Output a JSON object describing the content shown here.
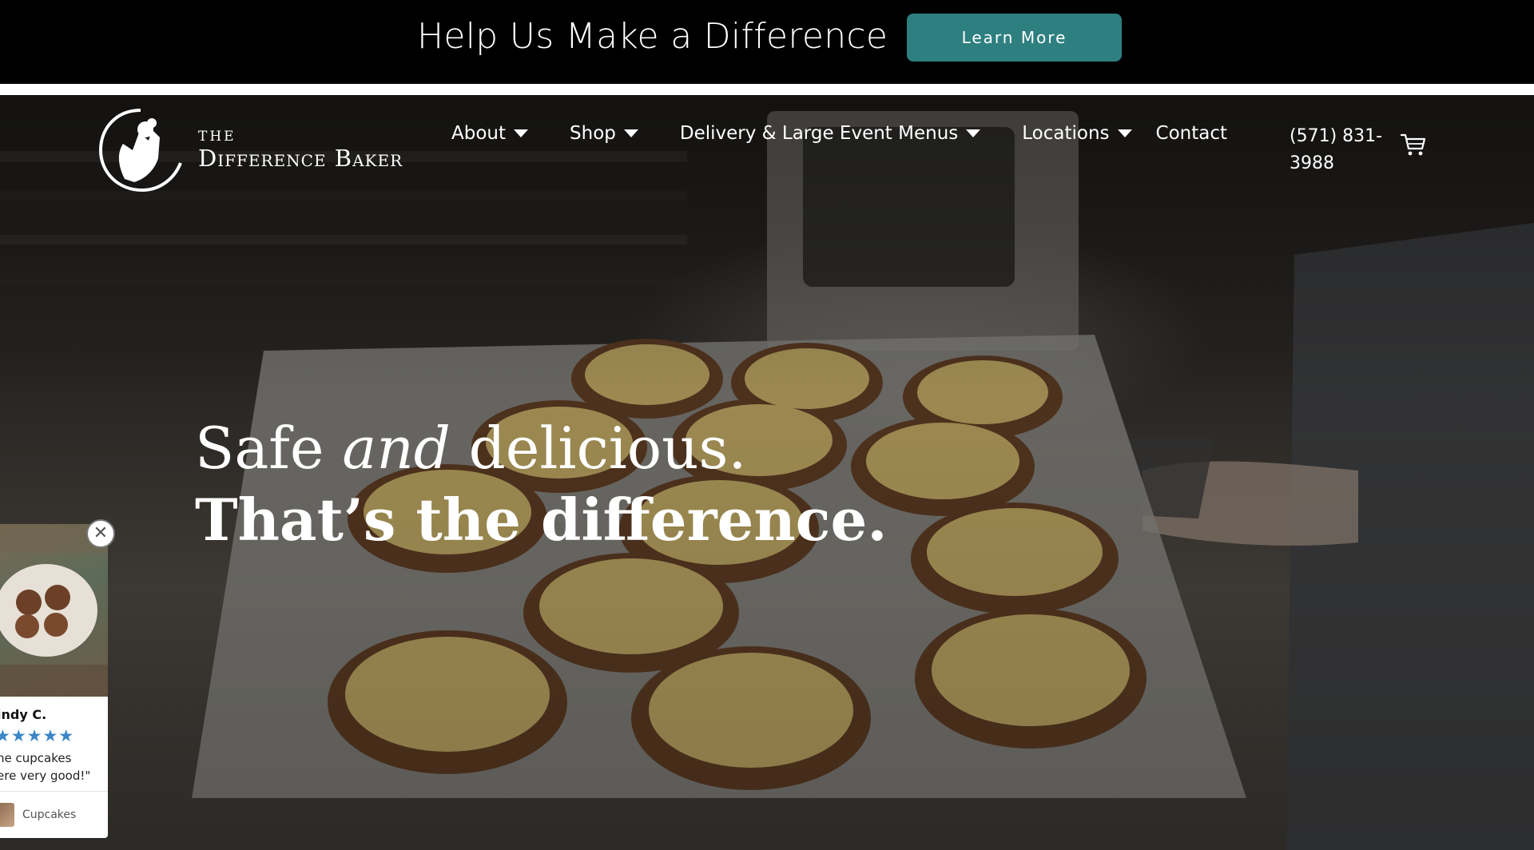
{
  "announcement": {
    "text": "Help Us Make a Difference",
    "button_label": "Learn More",
    "button_color": "#2e7f80"
  },
  "logo": {
    "the": "THE",
    "name": "Difference Baker",
    "icon": "praying-hands-cupcake-icon"
  },
  "nav": {
    "items": [
      {
        "label": "About",
        "has_dropdown": true
      },
      {
        "label": "Shop",
        "has_dropdown": true
      },
      {
        "label": "Delivery & Large Event Menus",
        "has_dropdown": true
      },
      {
        "label": "Locations",
        "has_dropdown": true
      },
      {
        "label": "Contact",
        "has_dropdown": false
      }
    ],
    "phone_line1": "(571) 831-",
    "phone_line2": "3988",
    "cart_icon": "cart-icon"
  },
  "hero": {
    "line1_start": "Safe ",
    "line1_italic": "and",
    "line1_end": " delicious.",
    "line2": "That’s the difference."
  },
  "review": {
    "name": "indy C.",
    "stars": "★★★★★",
    "rating": 5,
    "quote": "he cupcakes ere very good!\"",
    "quote_line1": "he cupcakes",
    "quote_line2": "ere very good!\"",
    "product": "Cupcakes",
    "star_color": "#3a86c8",
    "close_icon": "close-icon"
  }
}
